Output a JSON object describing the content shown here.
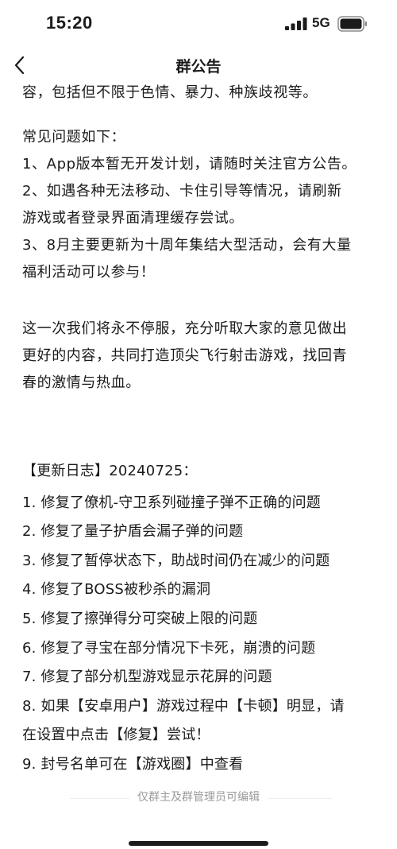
{
  "status_bar": {
    "time": "15:20",
    "network": "5G",
    "icons": [
      "signal-icon",
      "battery-icon"
    ]
  },
  "nav": {
    "title": "群公告",
    "back_icon": "chevron-left-icon"
  },
  "notice": {
    "intro_tail": "容，包括但不限于色情、暴力、种族歧视等。",
    "faq": [
      "常见问题如下：",
      "1、App版本暂无开发计划，请随时关注官方公告。",
      "2、如遇各种无法移动、卡住引导等情况，请刷新",
      "游戏或者登录界面清理缓存尝试。",
      "3、8月主要更新为十周年集结大型活动，会有大量",
      "福利活动可以参与！"
    ],
    "closing": [
      "这一次我们将永不停服，充分听取大家的意见做出",
      "更好的内容，共同打造顶尖飞行射击游戏，找回青",
      "春的激情与热血。"
    ],
    "changelog_title": "【更新日志】20240725：",
    "changelog": [
      "1. 修复了僚机-守卫系列碰撞子弹不正确的问题",
      "2. 修复了量子护盾会漏子弹的问题",
      "3. 修复了暂停状态下，助战时间仍在减少的问题",
      "4. 修复了BOSS被秒杀的漏洞",
      "5. 修复了擦弹得分可突破上限的问题",
      "6. 修复了寻宝在部分情况下卡死，崩溃的问题",
      "7. 修复了部分机型游戏显示花屏的问题",
      "8. 如果【安卓用户】游戏过程中【卡顿】明显，请",
      "在设置中点击【修复】尝试！",
      "9. 封号名单可在【游戏圈】中查看"
    ]
  },
  "footer": {
    "note": "仅群主及群管理员可编辑"
  }
}
